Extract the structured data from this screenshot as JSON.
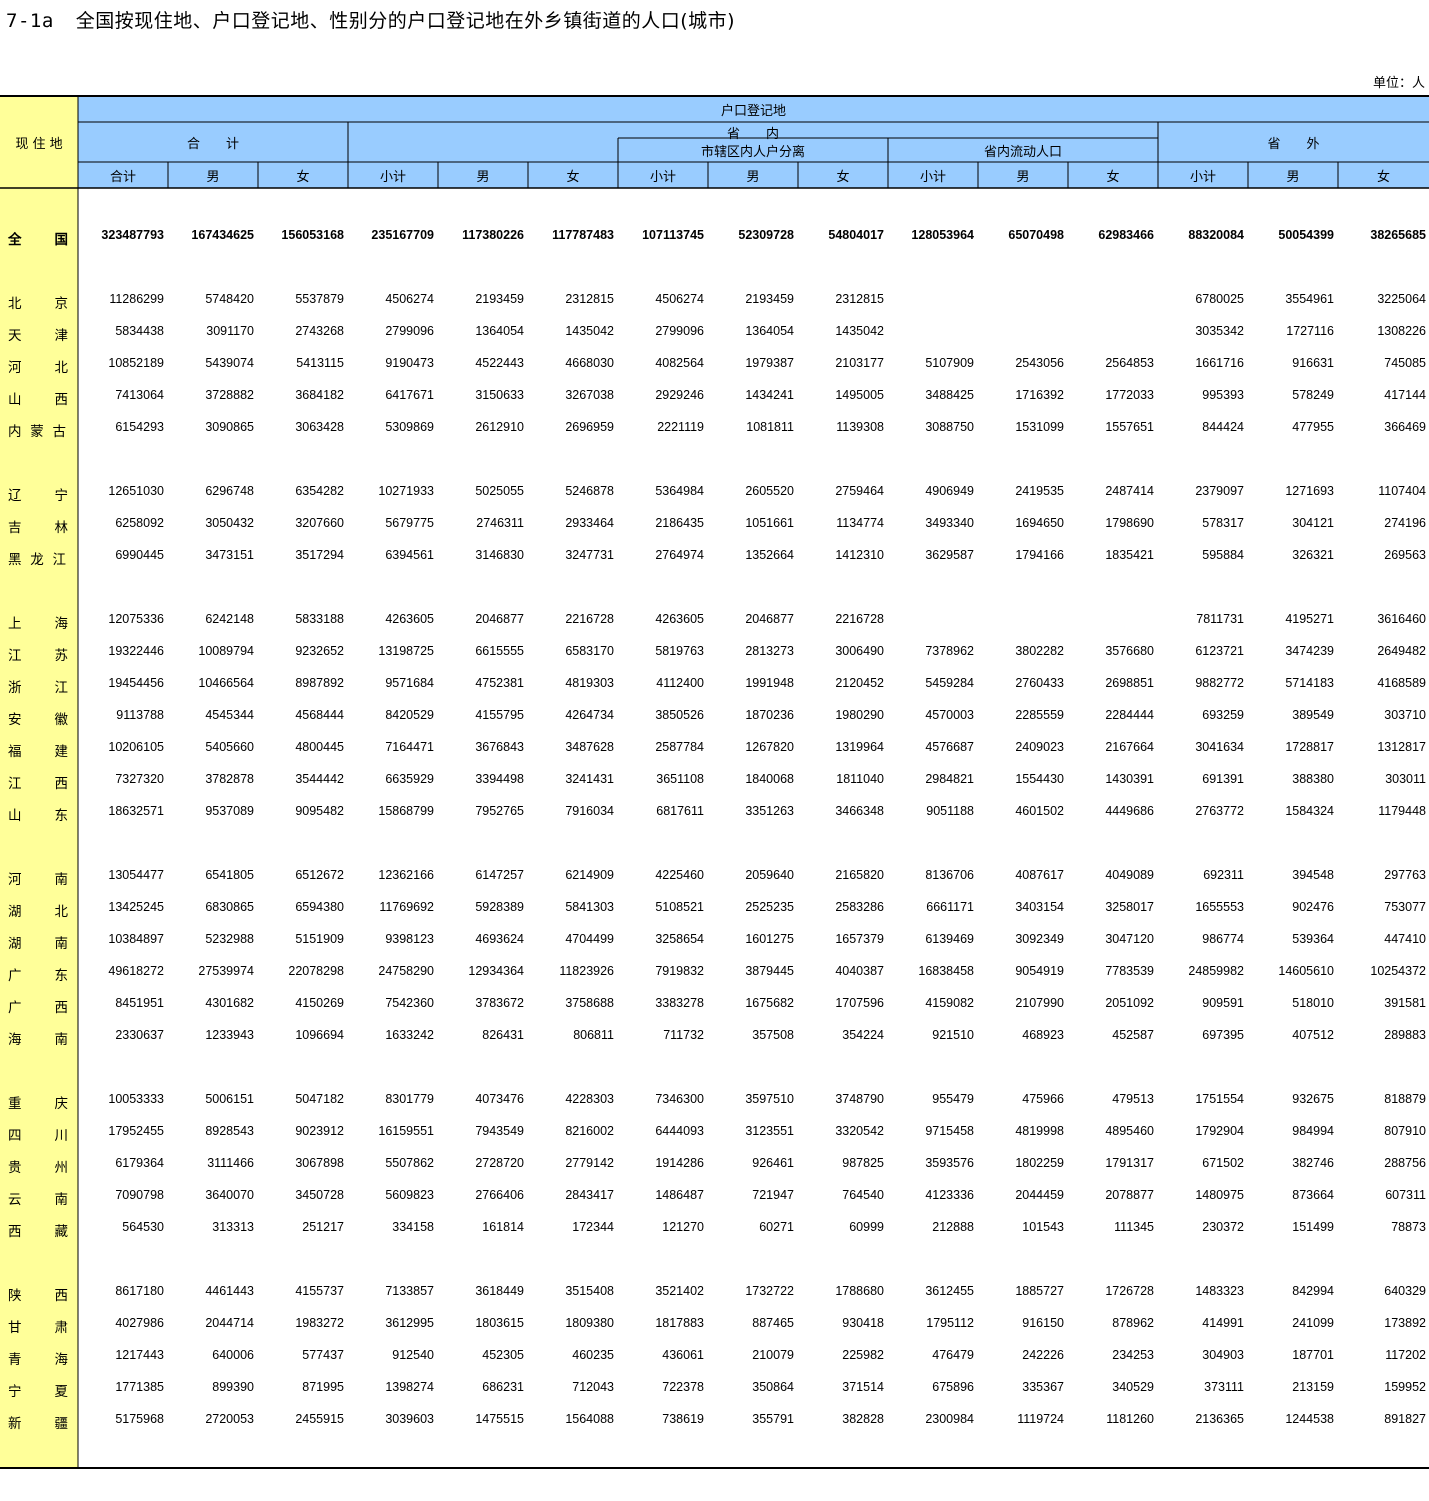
{
  "title": {
    "code": "7-1a",
    "text": "全国按现住地、户口登记地、性别分的户口登记地在外乡镇街道的人口(城市)"
  },
  "unit": "单位：人",
  "header": {
    "residence": "现 住 地",
    "registration": "户口登记地",
    "total_group": "合　　计",
    "in_province": "省　　内",
    "out_province": "省　　外",
    "city_separation": "市辖区内人户分离",
    "intra_province_floating": "省内流动人口",
    "cols": [
      "合计",
      "男",
      "女",
      "小计",
      "男",
      "女",
      "小计",
      "男",
      "女",
      "小计",
      "男",
      "女",
      "小计",
      "男",
      "女"
    ]
  },
  "rows": [
    {
      "label": "全国",
      "values": [
        "323487793",
        "167434625",
        "156053168",
        "235167709",
        "117380226",
        "117787483",
        "107113745",
        "52309728",
        "54804017",
        "128053964",
        "65070498",
        "62983466",
        "88320084",
        "50054399",
        "38265685"
      ]
    },
    {
      "label": "北京",
      "values": [
        "11286299",
        "5748420",
        "5537879",
        "4506274",
        "2193459",
        "2312815",
        "4506274",
        "2193459",
        "2312815",
        "",
        "",
        "",
        "6780025",
        "3554961",
        "3225064"
      ]
    },
    {
      "label": "天津",
      "values": [
        "5834438",
        "3091170",
        "2743268",
        "2799096",
        "1364054",
        "1435042",
        "2799096",
        "1364054",
        "1435042",
        "",
        "",
        "",
        "3035342",
        "1727116",
        "1308226"
      ]
    },
    {
      "label": "河北",
      "values": [
        "10852189",
        "5439074",
        "5413115",
        "9190473",
        "4522443",
        "4668030",
        "4082564",
        "1979387",
        "2103177",
        "5107909",
        "2543056",
        "2564853",
        "1661716",
        "916631",
        "745085"
      ]
    },
    {
      "label": "山西",
      "values": [
        "7413064",
        "3728882",
        "3684182",
        "6417671",
        "3150633",
        "3267038",
        "2929246",
        "1434241",
        "1495005",
        "3488425",
        "1716392",
        "1772033",
        "995393",
        "578249",
        "417144"
      ]
    },
    {
      "label": "内蒙古",
      "values": [
        "6154293",
        "3090865",
        "3063428",
        "5309869",
        "2612910",
        "2696959",
        "2221119",
        "1081811",
        "1139308",
        "3088750",
        "1531099",
        "1557651",
        "844424",
        "477955",
        "366469"
      ]
    },
    {
      "label": "辽宁",
      "values": [
        "12651030",
        "6296748",
        "6354282",
        "10271933",
        "5025055",
        "5246878",
        "5364984",
        "2605520",
        "2759464",
        "4906949",
        "2419535",
        "2487414",
        "2379097",
        "1271693",
        "1107404"
      ]
    },
    {
      "label": "吉林",
      "values": [
        "6258092",
        "3050432",
        "3207660",
        "5679775",
        "2746311",
        "2933464",
        "2186435",
        "1051661",
        "1134774",
        "3493340",
        "1694650",
        "1798690",
        "578317",
        "304121",
        "274196"
      ]
    },
    {
      "label": "黑龙江",
      "values": [
        "6990445",
        "3473151",
        "3517294",
        "6394561",
        "3146830",
        "3247731",
        "2764974",
        "1352664",
        "1412310",
        "3629587",
        "1794166",
        "1835421",
        "595884",
        "326321",
        "269563"
      ]
    },
    {
      "label": "上海",
      "values": [
        "12075336",
        "6242148",
        "5833188",
        "4263605",
        "2046877",
        "2216728",
        "4263605",
        "2046877",
        "2216728",
        "",
        "",
        "",
        "7811731",
        "4195271",
        "3616460"
      ]
    },
    {
      "label": "江苏",
      "values": [
        "19322446",
        "10089794",
        "9232652",
        "13198725",
        "6615555",
        "6583170",
        "5819763",
        "2813273",
        "3006490",
        "7378962",
        "3802282",
        "3576680",
        "6123721",
        "3474239",
        "2649482"
      ]
    },
    {
      "label": "浙江",
      "values": [
        "19454456",
        "10466564",
        "8987892",
        "9571684",
        "4752381",
        "4819303",
        "4112400",
        "1991948",
        "2120452",
        "5459284",
        "2760433",
        "2698851",
        "9882772",
        "5714183",
        "4168589"
      ]
    },
    {
      "label": "安徽",
      "values": [
        "9113788",
        "4545344",
        "4568444",
        "8420529",
        "4155795",
        "4264734",
        "3850526",
        "1870236",
        "1980290",
        "4570003",
        "2285559",
        "2284444",
        "693259",
        "389549",
        "303710"
      ]
    },
    {
      "label": "福建",
      "values": [
        "10206105",
        "5405660",
        "4800445",
        "7164471",
        "3676843",
        "3487628",
        "2587784",
        "1267820",
        "1319964",
        "4576687",
        "2409023",
        "2167664",
        "3041634",
        "1728817",
        "1312817"
      ]
    },
    {
      "label": "江西",
      "values": [
        "7327320",
        "3782878",
        "3544442",
        "6635929",
        "3394498",
        "3241431",
        "3651108",
        "1840068",
        "1811040",
        "2984821",
        "1554430",
        "1430391",
        "691391",
        "388380",
        "303011"
      ]
    },
    {
      "label": "山东",
      "values": [
        "18632571",
        "9537089",
        "9095482",
        "15868799",
        "7952765",
        "7916034",
        "6817611",
        "3351263",
        "3466348",
        "9051188",
        "4601502",
        "4449686",
        "2763772",
        "1584324",
        "1179448"
      ]
    },
    {
      "label": "河南",
      "values": [
        "13054477",
        "6541805",
        "6512672",
        "12362166",
        "6147257",
        "6214909",
        "4225460",
        "2059640",
        "2165820",
        "8136706",
        "4087617",
        "4049089",
        "692311",
        "394548",
        "297763"
      ]
    },
    {
      "label": "湖北",
      "values": [
        "13425245",
        "6830865",
        "6594380",
        "11769692",
        "5928389",
        "5841303",
        "5108521",
        "2525235",
        "2583286",
        "6661171",
        "3403154",
        "3258017",
        "1655553",
        "902476",
        "753077"
      ]
    },
    {
      "label": "湖南",
      "values": [
        "10384897",
        "5232988",
        "5151909",
        "9398123",
        "4693624",
        "4704499",
        "3258654",
        "1601275",
        "1657379",
        "6139469",
        "3092349",
        "3047120",
        "986774",
        "539364",
        "447410"
      ]
    },
    {
      "label": "广东",
      "values": [
        "49618272",
        "27539974",
        "22078298",
        "24758290",
        "12934364",
        "11823926",
        "7919832",
        "3879445",
        "4040387",
        "16838458",
        "9054919",
        "7783539",
        "24859982",
        "14605610",
        "10254372"
      ]
    },
    {
      "label": "广西",
      "values": [
        "8451951",
        "4301682",
        "4150269",
        "7542360",
        "3783672",
        "3758688",
        "3383278",
        "1675682",
        "1707596",
        "4159082",
        "2107990",
        "2051092",
        "909591",
        "518010",
        "391581"
      ]
    },
    {
      "label": "海南",
      "values": [
        "2330637",
        "1233943",
        "1096694",
        "1633242",
        "826431",
        "806811",
        "711732",
        "357508",
        "354224",
        "921510",
        "468923",
        "452587",
        "697395",
        "407512",
        "289883"
      ]
    },
    {
      "label": "重庆",
      "values": [
        "10053333",
        "5006151",
        "5047182",
        "8301779",
        "4073476",
        "4228303",
        "7346300",
        "3597510",
        "3748790",
        "955479",
        "475966",
        "479513",
        "1751554",
        "932675",
        "818879"
      ]
    },
    {
      "label": "四川",
      "values": [
        "17952455",
        "8928543",
        "9023912",
        "16159551",
        "7943549",
        "8216002",
        "6444093",
        "3123551",
        "3320542",
        "9715458",
        "4819998",
        "4895460",
        "1792904",
        "984994",
        "807910"
      ]
    },
    {
      "label": "贵州",
      "values": [
        "6179364",
        "3111466",
        "3067898",
        "5507862",
        "2728720",
        "2779142",
        "1914286",
        "926461",
        "987825",
        "3593576",
        "1802259",
        "1791317",
        "671502",
        "382746",
        "288756"
      ]
    },
    {
      "label": "云南",
      "values": [
        "7090798",
        "3640070",
        "3450728",
        "5609823",
        "2766406",
        "2843417",
        "1486487",
        "721947",
        "764540",
        "4123336",
        "2044459",
        "2078877",
        "1480975",
        "873664",
        "607311"
      ]
    },
    {
      "label": "西藏",
      "values": [
        "564530",
        "313313",
        "251217",
        "334158",
        "161814",
        "172344",
        "121270",
        "60271",
        "60999",
        "212888",
        "101543",
        "111345",
        "230372",
        "151499",
        "78873"
      ]
    },
    {
      "label": "陕西",
      "values": [
        "8617180",
        "4461443",
        "4155737",
        "7133857",
        "3618449",
        "3515408",
        "3521402",
        "1732722",
        "1788680",
        "3612455",
        "1885727",
        "1726728",
        "1483323",
        "842994",
        "640329"
      ]
    },
    {
      "label": "甘肃",
      "values": [
        "4027986",
        "2044714",
        "1983272",
        "3612995",
        "1803615",
        "1809380",
        "1817883",
        "887465",
        "930418",
        "1795112",
        "916150",
        "878962",
        "414991",
        "241099",
        "173892"
      ]
    },
    {
      "label": "青海",
      "values": [
        "1217443",
        "640006",
        "577437",
        "912540",
        "452305",
        "460235",
        "436061",
        "210079",
        "225982",
        "476479",
        "242226",
        "234253",
        "304903",
        "187701",
        "117202"
      ]
    },
    {
      "label": "宁夏",
      "values": [
        "1771385",
        "899390",
        "871995",
        "1398274",
        "686231",
        "712043",
        "722378",
        "350864",
        "371514",
        "675896",
        "335367",
        "340529",
        "373111",
        "213159",
        "159952"
      ]
    },
    {
      "label": "新疆",
      "values": [
        "5175968",
        "2720053",
        "2455915",
        "3039603",
        "1475515",
        "1564088",
        "738619",
        "355791",
        "382828",
        "2300984",
        "1119724",
        "1181260",
        "2136365",
        "1244538",
        "891827"
      ]
    }
  ]
}
